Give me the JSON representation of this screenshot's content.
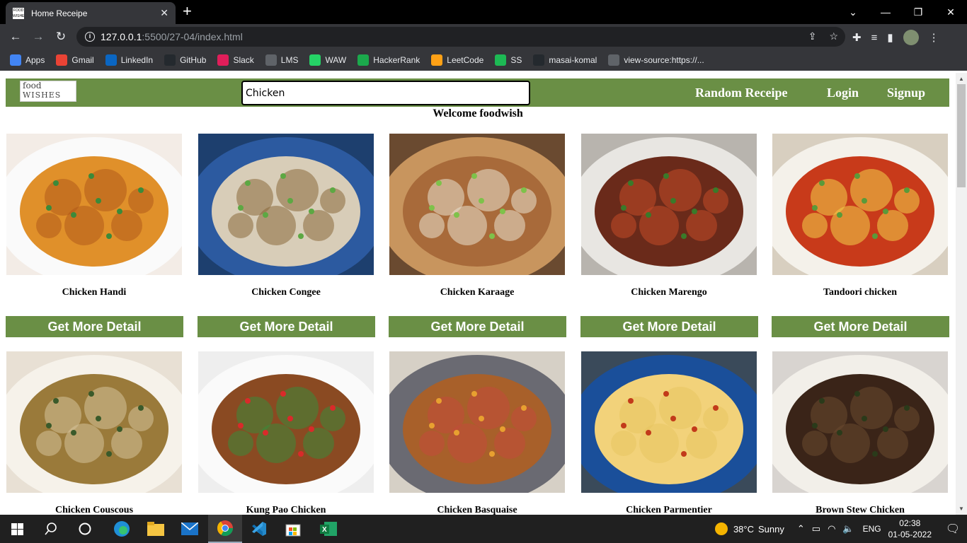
{
  "browser": {
    "tab_title": "Home Receipe",
    "favicon_text": "FOOD WISHES",
    "url_host": "127.0.0.1",
    "url_path": ":5500/27-04/index.html",
    "bookmarks": [
      {
        "label": "Apps",
        "icon": "apps-grid-icon",
        "color": "#4285f4"
      },
      {
        "label": "Gmail",
        "icon": "gmail-icon",
        "color": "#ea4335"
      },
      {
        "label": "LinkedIn",
        "icon": "linkedin-icon",
        "color": "#0a66c2"
      },
      {
        "label": "GitHub",
        "icon": "github-icon",
        "color": "#24292e"
      },
      {
        "label": "Slack",
        "icon": "slack-icon",
        "color": "#e01e5a"
      },
      {
        "label": "LMS",
        "icon": "globe-icon",
        "color": "#5f6368"
      },
      {
        "label": "WAW",
        "icon": "whatsapp-icon",
        "color": "#25d366"
      },
      {
        "label": "HackerRank",
        "icon": "hackerrank-icon",
        "color": "#1ba94c"
      },
      {
        "label": "LeetCode",
        "icon": "leetcode-icon",
        "color": "#ffa116"
      },
      {
        "label": "SS",
        "icon": "spotify-icon",
        "color": "#1db954"
      },
      {
        "label": "masai-komal",
        "icon": "github-icon",
        "color": "#24292e"
      },
      {
        "label": "view-source:https://...",
        "icon": "globe-icon",
        "color": "#5f6368"
      }
    ]
  },
  "page": {
    "logo_line1": "food",
    "logo_line2": "WISHES",
    "search_value": "Chicken",
    "nav": {
      "random": "Random Receipe",
      "login": "Login",
      "signup": "Signup"
    },
    "welcome": "Welcome foodwish",
    "button_label": "Get More Detail",
    "recipes": [
      {
        "name": "Chicken Handi"
      },
      {
        "name": "Chicken Congee"
      },
      {
        "name": "Chicken Karaage"
      },
      {
        "name": "Chicken Marengo"
      },
      {
        "name": "Tandoori chicken"
      },
      {
        "name": "Chicken Couscous"
      },
      {
        "name": "Kung Pao Chicken"
      },
      {
        "name": "Chicken Basquaise"
      },
      {
        "name": "Chicken Parmentier"
      },
      {
        "name": "Brown Stew Chicken"
      }
    ]
  },
  "taskbar": {
    "weather_temp": "38°C",
    "weather_desc": "Sunny",
    "lang": "ENG",
    "time": "02:38",
    "date": "01-05-2022"
  },
  "colors": {
    "nav_green": "#6a8f45",
    "chrome_dark": "#35363a"
  }
}
